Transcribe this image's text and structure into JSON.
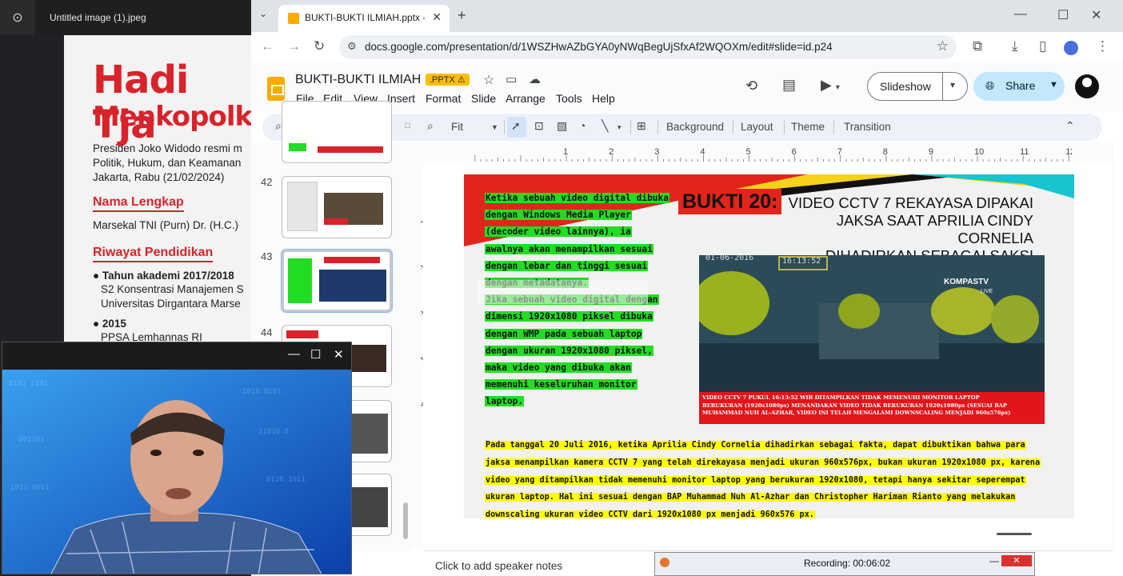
{
  "viewer": {
    "title": "Untitled image (1).jpeg",
    "page": {
      "headline1": "Hadi Tja",
      "headline2": "Menkopolk",
      "intro1": "Presiden Joko Widodo resmi m",
      "intro2": "Politik, Hukum, dan Keamanan",
      "intro3": "Jakarta, Rabu (21/02/2024)",
      "section_name": "Nama Lengkap",
      "full_name": "Marsekal TNI (Purn) Dr. (H.C.)",
      "section_edu": "Riwayat Pendidikan",
      "edu1_year": "Tahun akademi 2017/2018",
      "edu1_line1": "S2 Konsentrasi Manajemen S",
      "edu1_line2": "Universitas Dirgantara Marse",
      "edu2_year": "2015",
      "edu2_line1": "PPSA Lemhannas RI"
    }
  },
  "browser": {
    "tab_title": "BUKTI-BUKTI ILMIAH.pptx - Go",
    "url": "docs.google.com/presentation/d/1WSZHwAZbGYA0yNWqBegUjSfxAf2WQOXm/edit#slide=id.p24"
  },
  "slides": {
    "doc_title": "BUKTI-BUKTI ILMIAH",
    "badge": ".PPTX",
    "menu": [
      "File",
      "Edit",
      "View",
      "Insert",
      "Format",
      "Slide",
      "Arrange",
      "Tools",
      "Help"
    ],
    "slideshow_label": "Slideshow",
    "share_label": "Share",
    "toolbar": {
      "zoom_label": "Fit",
      "background": "Background",
      "layout": "Layout",
      "theme": "Theme",
      "transition": "Transition"
    },
    "ruler_marks": [
      "1",
      "2",
      "3",
      "4",
      "5",
      "6",
      "7",
      "8",
      "9",
      "10",
      "11",
      "12",
      "13"
    ],
    "ruler_v_marks": [
      "1",
      "2",
      "3",
      "4",
      "5"
    ],
    "filmstrip_numbers": [
      "42",
      "43",
      "44"
    ],
    "speaker_notes_placeholder": "Click to add speaker notes"
  },
  "slide": {
    "bukti_label": "BUKTI 20:",
    "title_line1": "VIDEO CCTV 7 REKAYASA DIPAKAI",
    "title_line2": "JAKSA SAAT APRILIA CINDY CORNELIA",
    "title_line3": "DIHADIRKAN SEBAGAI SAKSI FAKTA",
    "green_lines": [
      "Ketika sebuah video digital dibuka",
      "dengan Windows Media Player",
      "(decoder video lainnya), ia",
      "awalnya akan menampilkan sesuai",
      "dengan lebar dan tinggi sesuai",
      "dengan metadatanya.",
      "Jika sebuah video digital dengan",
      "dimensi 1920x1080 piksel dibuka",
      "dengan WMP pada sebuah laptop",
      "dengan ukuran 1920x1080 piksel,",
      "maka video yang dibuka akan",
      "memenuhi keseluruhan monitor",
      "laptop."
    ],
    "cctv_timestamp": "01-06-2016",
    "cctv_time": "16:13:52",
    "cctv_brand": "KOMPASTV",
    "cctv_live": "LIVE",
    "caption_line1": "VIDEO CCTV 7 PUKUL 16:13:52 WIB DITAMPILKAN TIDAK MEMENUHI MONITOR LAPTOP",
    "caption_line2": "BERUKURAN (1920x1080px)  MENANDAKAN VIDEO TIDAK BERUKURAN 1920x1080px (SESUAI BAP",
    "caption_line3": "MUHAMMAD NUH AL-AZHAR, VIDEO INI TELAH MENGALAMI DOWNSCALING MENJADI 960x576px)",
    "yellow_lines": [
      "Pada tanggal 20 Juli 2016, ketika Aprilia Cindy Cornelia dihadirkan sebagai fakta, dapat dibuktikan bahwa para",
      "jaksa menampilkan kamera CCTV 7 yang telah direkayasa menjadi ukuran 960x576px, bukan ukuran 1920x1080 px, karena",
      "video yang ditampilkan tidak memenuhi monitor laptop yang berukuran 1920x1080, tetapi hanya sekitar seperempat",
      "ukuran laptop. Hal ini sesuai dengan BAP Muhammad Nuh Al-Azhar dan Christopher Hariman Rianto yang melakukan",
      "downscaling ukuran video CCTV dari 1920x1080 px menjadi 960x576 px."
    ]
  },
  "recording": {
    "label": "Recording:  00:06:02"
  },
  "colors": {
    "accent_red": "#d8232a",
    "highlight_green": "#22dd22",
    "highlight_yellow": "#ffff00",
    "share_blue": "#c2e7ff"
  }
}
